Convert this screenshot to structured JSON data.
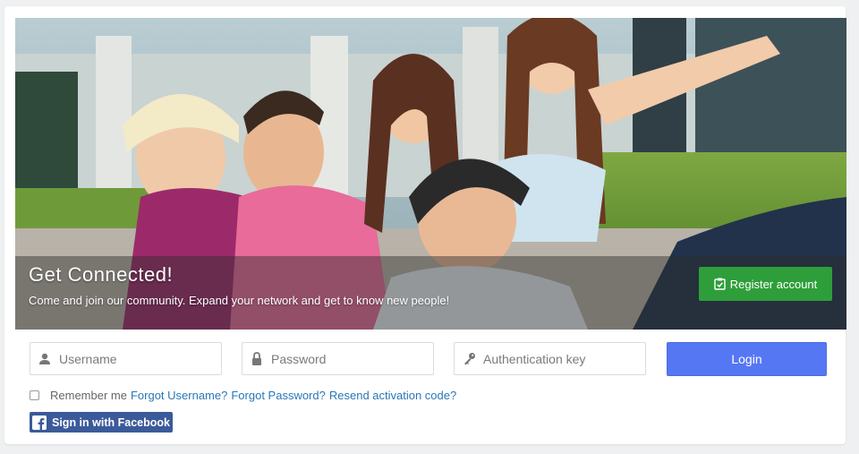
{
  "hero": {
    "title": "Get Connected!",
    "subtitle": "Come and join our community. Expand your network and get to know new people!",
    "register_label": "Register account"
  },
  "login_form": {
    "username_placeholder": "Username",
    "password_placeholder": "Password",
    "auth_key_placeholder": "Authentication key",
    "login_label": "Login",
    "remember_label": "Remember me",
    "forgot_username": "Forgot Username?",
    "forgot_password": "Forgot Password?",
    "resend_activation": "Resend activation code?",
    "facebook_label": "Sign in with Facebook"
  },
  "icons": {
    "username": "user-icon",
    "password": "lock-icon",
    "auth_key": "key-icon",
    "register": "clipboard-check-icon",
    "facebook": "facebook-logo-icon"
  },
  "colors": {
    "register_button": "#2e9e3a",
    "login_button": "#5677f3",
    "facebook_button": "#3b5a9a",
    "link": "#2a76b7"
  }
}
